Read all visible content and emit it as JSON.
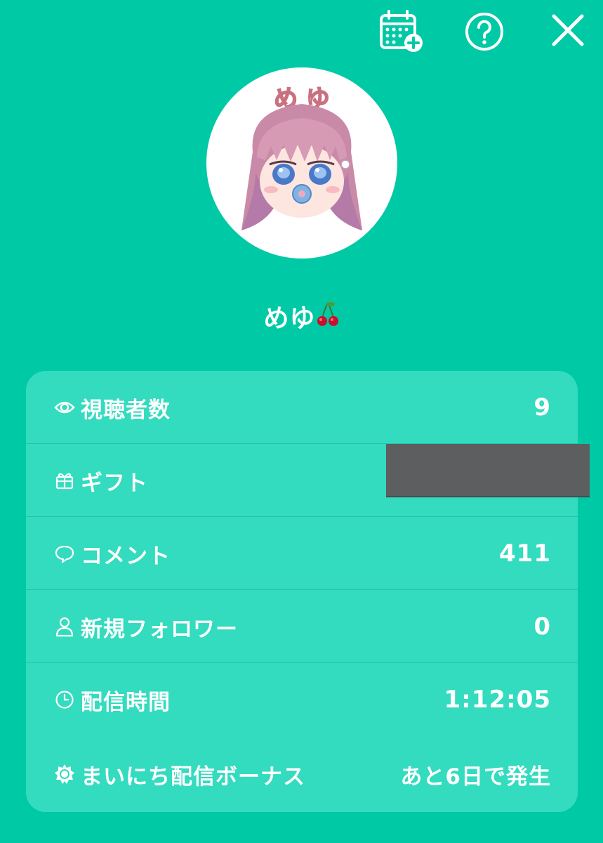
{
  "header": {
    "calendar_icon": "calendar-add-icon",
    "help_icon": "help-circle-icon",
    "close_icon": "close-icon"
  },
  "profile": {
    "avatar_text": "め ゆ",
    "username": "めゆ",
    "username_emoji": "cherry"
  },
  "stats": [
    {
      "icon": "eye-icon",
      "label": "視聴者数",
      "value": "9"
    },
    {
      "icon": "gift-icon",
      "label": "ギフト",
      "value": ""
    },
    {
      "icon": "comment-icon",
      "label": "コメント",
      "value": "411"
    },
    {
      "icon": "person-icon",
      "label": "新規フォロワー",
      "value": "0"
    },
    {
      "icon": "clock-icon",
      "label": "配信時間",
      "value": "1:12:05"
    },
    {
      "icon": "sun-icon",
      "label": "まいにち配信ボーナス",
      "value": "あと6日で発生"
    }
  ],
  "colors": {
    "background": "#00c9a5",
    "card": "#33dbbf",
    "text": "#ffffff",
    "redaction": "#5c5e5f"
  }
}
